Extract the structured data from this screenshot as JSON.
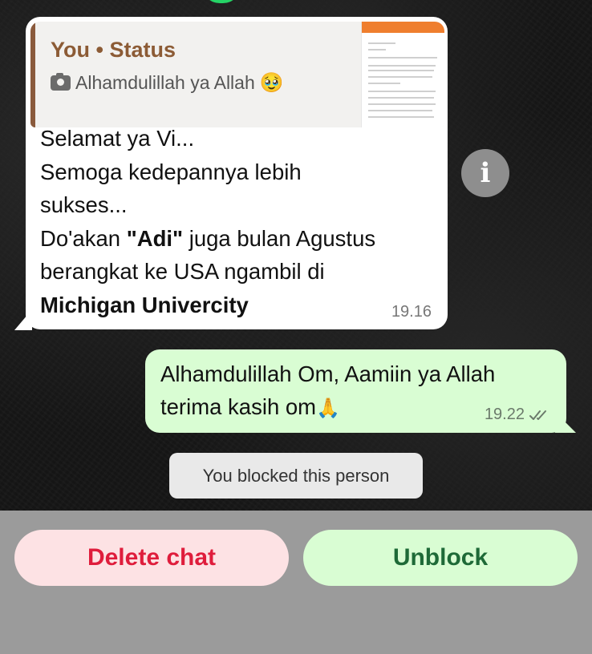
{
  "incoming": {
    "quote": {
      "author": "You • Status",
      "text": "Alhamdulillah ya Allah",
      "emoji": "🥹"
    },
    "lines": {
      "l1": "Selamat ya Vi...",
      "l2": "Semoga kedepannya lebih",
      "l3": "sukses...",
      "l4a": "Do'akan ",
      "l4b": "\"Adi\"",
      "l4c": " juga bulan Agustus",
      "l5": "berangkat ke USA ngambil di",
      "l6": "Michigan Univercity"
    },
    "time": "19.16"
  },
  "info_button": {
    "label": "i"
  },
  "outgoing": {
    "line1": "Alhamdulillah Om, Aamiin ya Allah",
    "line2": "terima kasih om",
    "emoji": "🙏",
    "time": "19.22",
    "status_icon": "double-check-icon"
  },
  "system_message": "You blocked this person",
  "actions": {
    "delete_label": "Delete chat",
    "unblock_label": "Unblock"
  },
  "colors": {
    "incoming_bubble": "#ffffff",
    "outgoing_bubble": "#d9fdd3",
    "delete_text": "#df1d3c",
    "unblock_text": "#1e6a37",
    "quote_author": "#8c5b35",
    "quote_bar": "#8a5a3c"
  }
}
